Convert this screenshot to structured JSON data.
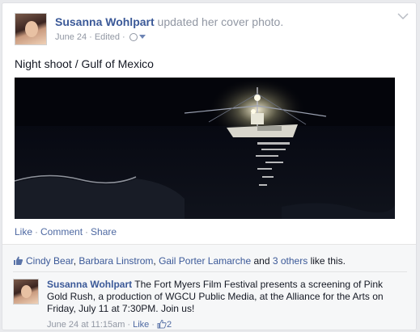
{
  "post": {
    "author": "Susanna Wohlpart",
    "action": "updated her cover photo.",
    "date": "June 24",
    "edited": "Edited",
    "caption": "Night shoot / Gulf of Mexico"
  },
  "actions": {
    "like": "Like",
    "comment": "Comment",
    "share": "Share"
  },
  "likes": {
    "liker1": "Cindy Bear",
    "liker2": "Barbara Linstrom",
    "liker3": "Gail Porter Lamarche",
    "and": "and",
    "others": "3 others",
    "suffix": "like this."
  },
  "comment": {
    "author": "Susanna Wohlpart",
    "text": "The Fort Myers Film Festival presents a screening of Pink Gold Rush, a production of WGCU Public Media, at the Alliance for the Arts on Friday, July 11 at 7:30PM. Join us!",
    "time": "June 24 at 11:15am",
    "like": "Like",
    "like_count": "2"
  },
  "colors": {
    "link": "#3b5998",
    "meta": "#9197a3",
    "ufi_bg": "#f6f7f8"
  },
  "icons": [
    "globe-icon",
    "chevron-down-icon",
    "thumbs-up-icon"
  ]
}
